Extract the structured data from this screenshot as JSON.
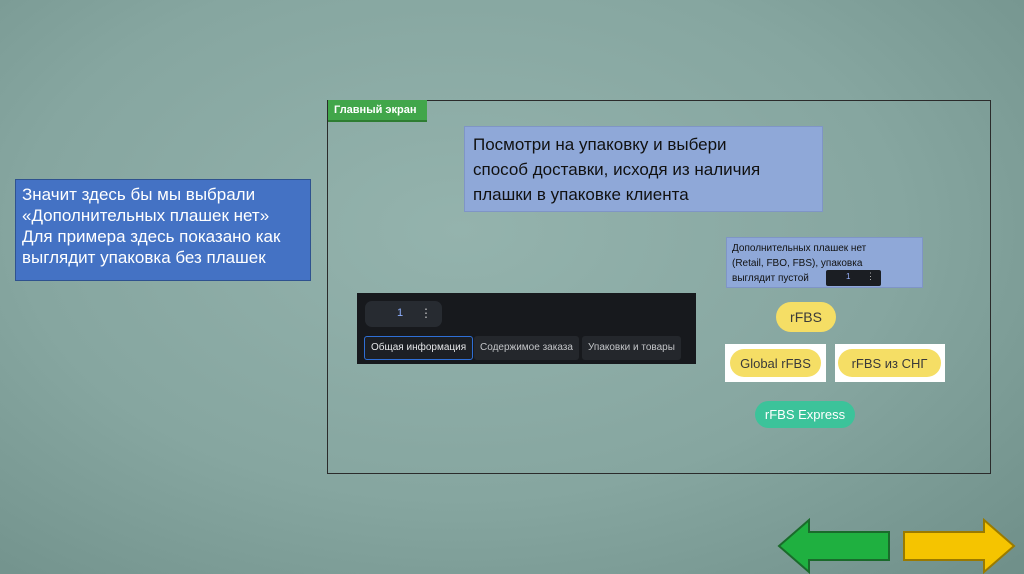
{
  "left_note": {
    "lines": [
      "Значит здесь бы мы выбрали",
      "«Дополнительных плашек нет»",
      "Для примера здесь показано как",
      "выглядит упаковка без плашек"
    ]
  },
  "frame": {
    "title": "Главный экран"
  },
  "instruction": {
    "lines": [
      "Посмотри на упаковку и выбери",
      "способ доставки, исходя из наличия",
      "плашки в упаковке клиента"
    ]
  },
  "small_note": {
    "lines": [
      "Дополнительных плашек нет",
      "(Retail, FBO, FBS), упаковка",
      "выглядит пустой"
    ],
    "chip_number": "1",
    "chip_menu": "⋮"
  },
  "package_panel": {
    "counter_value": "1",
    "menu_glyph": "⋮",
    "tabs": [
      {
        "label": "Общая информация",
        "active": true
      },
      {
        "label": "Содержимое заказа",
        "active": false
      },
      {
        "label": "Упаковки и товары",
        "active": false
      }
    ]
  },
  "badges": {
    "rfbs": "rFBS",
    "global_rfbs": "Global rFBS",
    "rfbs_sng": "rFBS из СНГ",
    "rfbs_express": "rFBS Express"
  },
  "colors": {
    "note_blue": "#4472c4",
    "light_blue": "#8fa8d8",
    "title_green": "#41a64a",
    "badge_yellow": "#f5de65",
    "badge_teal": "#3cc39a",
    "arrow_back": "#1fb040",
    "arrow_forward": "#f5c400"
  },
  "navigation": {
    "back_icon": "arrow-left-icon",
    "forward_icon": "arrow-right-icon"
  }
}
